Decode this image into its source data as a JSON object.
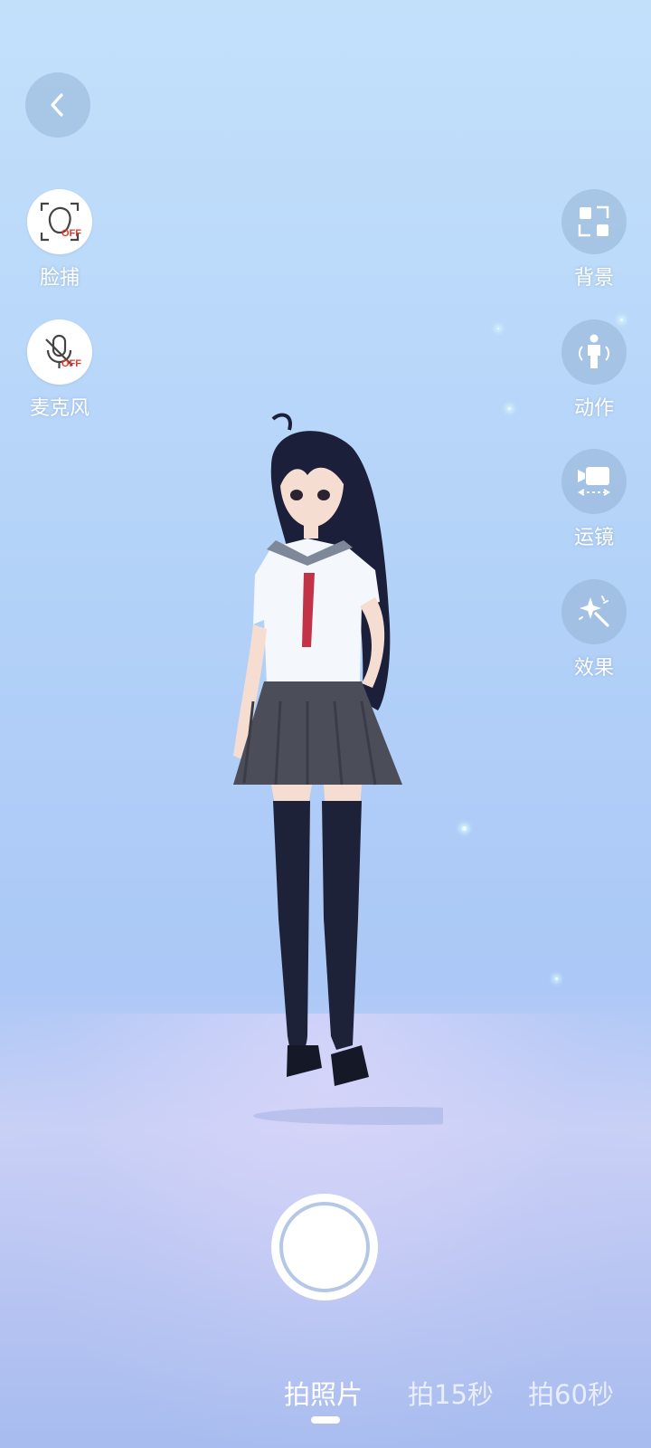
{
  "left_controls": {
    "face_capture": {
      "label": "脸捕",
      "badge": "OFF",
      "icon": "face-capture-icon"
    },
    "microphone": {
      "label": "麦克风",
      "badge": "OFF",
      "icon": "mic-off-icon"
    }
  },
  "right_controls": {
    "background": {
      "label": "背景",
      "icon": "background-grid-icon"
    },
    "motion": {
      "label": "动作",
      "icon": "person-icon"
    },
    "camera_movement": {
      "label": "运镜",
      "icon": "camera-move-icon"
    },
    "effects": {
      "label": "效果",
      "icon": "magic-wand-icon"
    }
  },
  "capture_modes": [
    "拍照片",
    "拍15秒",
    "拍60秒"
  ],
  "selected_mode": "拍照片",
  "colors": {
    "sky_top": "#c3e0fb",
    "sky_bottom": "#a7bcef",
    "button_dim": "#8caacd",
    "badge_red": "#e4382e"
  }
}
